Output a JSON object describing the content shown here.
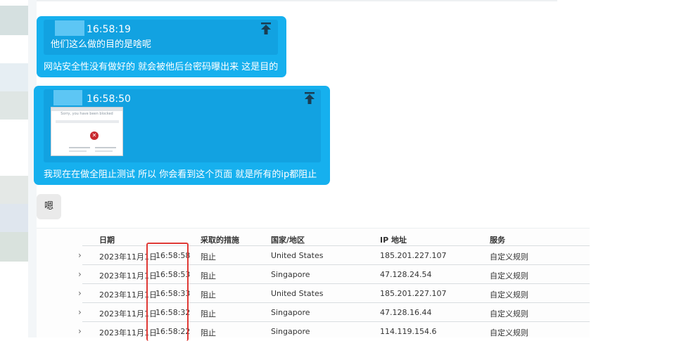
{
  "messages": [
    {
      "time": "16:58:19",
      "quote_text": "他们这么做的目的是啥呢",
      "text": "网站安全性没有做好的 就会被他后台密码曝出来 这是目的"
    },
    {
      "time": "16:58:50",
      "screenshot_title": "Sorry, you have been blocked",
      "text": "我现在在做全阻止测试  所以 你会看到这个页面  就是所有的ip都阻止"
    },
    {
      "text": "嗯"
    }
  ],
  "table": {
    "headers": [
      "日期",
      "采取的措施",
      "国家/地区",
      "IP 地址",
      "服务"
    ],
    "rows": [
      {
        "date": "2023年11月1日",
        "time": "16:58:58",
        "action": "阻止",
        "country": "United States",
        "ip": "185.201.227.107",
        "service": "自定义规则"
      },
      {
        "date": "2023年11月1日",
        "time": "16:58:53",
        "action": "阻止",
        "country": "Singapore",
        "ip": "47.128.24.54",
        "service": "自定义规则"
      },
      {
        "date": "2023年11月1日",
        "time": "16:58:33",
        "action": "阻止",
        "country": "United States",
        "ip": "185.201.227.107",
        "service": "自定义规则"
      },
      {
        "date": "2023年11月1日",
        "time": "16:58:32",
        "action": "阻止",
        "country": "Singapore",
        "ip": "47.128.16.44",
        "service": "自定义规则"
      },
      {
        "date": "2023年11月1日",
        "time": "16:58:22",
        "action": "阻止",
        "country": "Singapore",
        "ip": "114.119.154.6",
        "service": "自定义规则"
      }
    ]
  },
  "icons": {
    "pin": "pin-top-icon",
    "expand": "chevron-right-icon",
    "blocked": "blocked-x-icon"
  },
  "colors": {
    "bubble": "#16b0ee",
    "highlight": "#e03a36"
  }
}
